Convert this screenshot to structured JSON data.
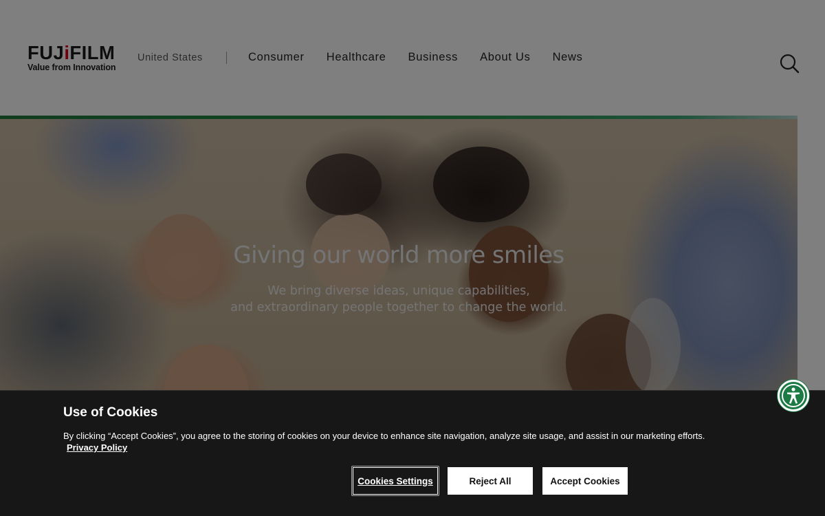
{
  "header": {
    "logo_word": "FUJIFILM",
    "logo_word_left": "FUJ",
    "logo_word_right": "FILM",
    "logo_tagline": "Value from Innovation",
    "region": "United States",
    "nav": [
      {
        "label": "Consumer"
      },
      {
        "label": "Healthcare"
      },
      {
        "label": "Business"
      },
      {
        "label": "About Us"
      },
      {
        "label": "News"
      }
    ],
    "search_icon": "search-icon"
  },
  "hero": {
    "title": "Giving our world more smiles",
    "subtitle_line1": "We bring diverse ideas, unique capabilities,",
    "subtitle_line2": "and extraordinary people together to change the world."
  },
  "cookie_banner": {
    "title": "Use of Cookies",
    "text": "By clicking “Accept Cookies”, you agree to the storing of cookies on your device to enhance site navigation, analyze site usage, and assist in our marketing efforts.",
    "privacy_link": "Privacy Policy",
    "settings_button": "Cookies Settings",
    "reject_button": "Reject All",
    "accept_button": "Accept Cookies"
  },
  "colors": {
    "brand_red": "#e60012",
    "brand_green": "#249046",
    "accessibility_green": "#1c7a45"
  },
  "icons": {
    "search": "search-icon",
    "pause": "pause-icon",
    "accessibility": "accessibility-icon"
  }
}
